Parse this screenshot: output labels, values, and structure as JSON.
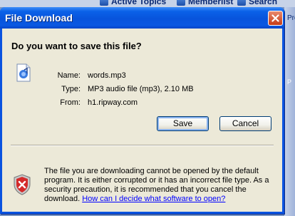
{
  "background": {
    "links": [
      {
        "label": "Active Topics",
        "icon": "topics-icon"
      },
      {
        "label": "Memberlist",
        "icon": "members-icon"
      },
      {
        "label": "Search",
        "icon": "search-icon"
      }
    ],
    "cut_text": "Pro",
    "cut_text2": "P"
  },
  "dialog": {
    "title": "File Download",
    "question": "Do you want to save this file?",
    "file": {
      "name_label": "Name:",
      "name": "words.mp3",
      "type_label": "Type:",
      "type": "MP3 audio file (mp3), 2.10 MB",
      "from_label": "From:",
      "from": "h1.ripway.com"
    },
    "buttons": {
      "save": "Save",
      "cancel": "Cancel"
    },
    "warning": {
      "text": "The file you are downloading cannot be opened by the default program. It is either corrupted or it has an incorrect file type. As a security precaution, it is recommended that you cancel the download.",
      "link": "How can I decide what software to open?"
    }
  },
  "colors": {
    "titlebar": "#0a58e2",
    "dialog_body": "#ece9d8",
    "link": "#0000ff"
  }
}
